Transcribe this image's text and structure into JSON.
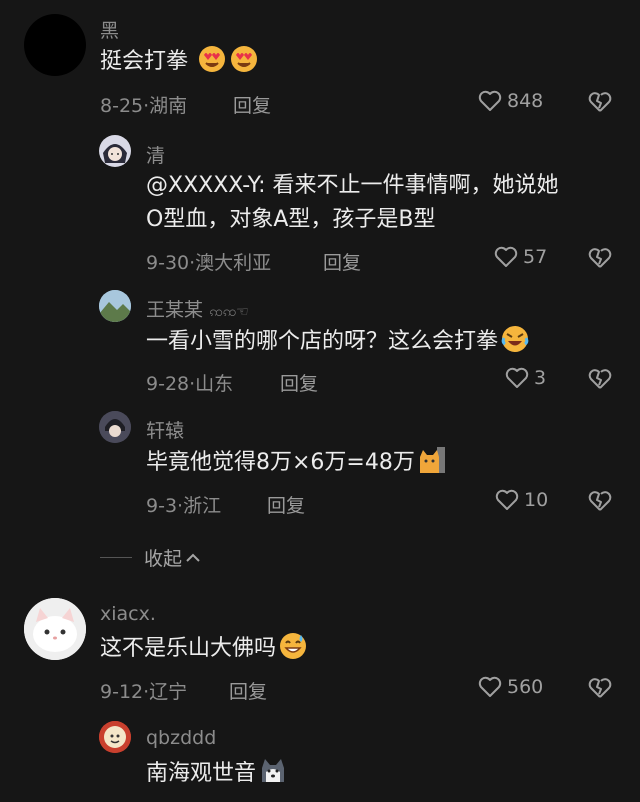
{
  "comments": [
    {
      "name": "黑",
      "text": "挺会打拳",
      "date": "8-25",
      "location": "湖南",
      "reply_label": "回复",
      "likes": "848",
      "avatar": "black-circle-avatar"
    },
    {
      "name": "清",
      "text_line1": "@XXXXX-Y: 看来不止一件事情啊，她说她",
      "text_line2": "O型血，对象A型，孩子是B型",
      "date": "9-30",
      "location": "澳大利亚",
      "reply_label": "回复",
      "likes": "57",
      "avatar": "anime-girl-avatar"
    },
    {
      "name": "王某某",
      "name_suffix": "ꩡꩡ☜",
      "text": "一看小雪的哪个店的呀？这么会打拳",
      "date": "9-28",
      "location": "山东",
      "reply_label": "回复",
      "likes": "3",
      "avatar": "landscape-avatar"
    },
    {
      "name": "轩辕",
      "text": "毕竟他觉得8万×6万=48万",
      "date": "9-3",
      "location": "浙江",
      "reply_label": "回复",
      "likes": "10",
      "avatar": "anime-boy-avatar"
    },
    {
      "name": "xiacx.",
      "text": "这不是乐山大佛吗",
      "date": "9-12",
      "location": "辽宁",
      "reply_label": "回复",
      "likes": "560",
      "avatar": "cat-avatar"
    },
    {
      "name": "qbzddd",
      "text": "南海观世音",
      "avatar": "cartoon-avatar"
    }
  ],
  "collapse_label": "收起",
  "colors": {
    "background": "#161616",
    "text": "#ececec",
    "secondary": "#8c8c8c"
  }
}
